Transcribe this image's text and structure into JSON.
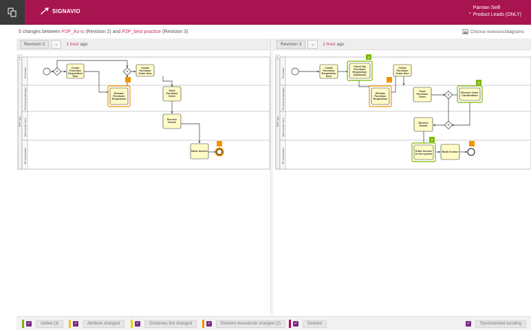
{
  "topbar": {
    "logo_text": "SIGNAVIO",
    "user_name": "Parnian Seifi",
    "user_role": "Product Leads (ONLY)",
    "app_icon": "copy-icon",
    "chevron_icon": "chevron-down-icon",
    "bg_color": "#a8144f"
  },
  "summary": {
    "count": "5",
    "text_a": " changes between ",
    "diagram_a": "P2P_As-is",
    "rev_a": " (Revision 2) and ",
    "diagram_b": "P2P_best practice",
    "rev_b": " (Revision 3)",
    "choose_label": "Choose revisions/diagrams"
  },
  "left": {
    "revision": "Revision 2",
    "time": "1 hour",
    "time_suffix": " ago",
    "pool": "ERP Sys...",
    "lanes": [
      "Purchaser",
      "Purchasing Manager",
      "Warehouse Clerk",
      "AP Accountant"
    ],
    "tasks": {
      "t1": [
        "Create",
        "Purchase",
        "Requisition",
        "Item"
      ],
      "t2": [
        "Create",
        "Purchase",
        "Order Item"
      ],
      "t3": [
        "Release",
        "Purchase",
        "Requisition"
      ],
      "t4": [
        "Send",
        "Purchase",
        "Order"
      ],
      "t5": [
        "Receive",
        "Goods"
      ],
      "t6": [
        "Book Invoice"
      ]
    }
  },
  "right": {
    "revision": "Revision 3",
    "time": "1 hour",
    "time_suffix": " ago",
    "pool": "ERP Sys...",
    "lanes": [
      "Purchaser",
      "Purchasing Manager",
      "Warehouse Clerk",
      "AP Accountant"
    ],
    "tasks": {
      "t1": [
        "Create",
        "Purchase",
        "Requisition",
        "Item"
      ],
      "t2": [
        "Check My",
        "Purchase",
        "Requisition",
        "(Optional)"
      ],
      "t3": [
        "Create",
        "Purchase",
        "Order Item"
      ],
      "t4": [
        "Release",
        "Purchase",
        "Requisition"
      ],
      "t5": [
        "Send",
        "Purchase",
        "Order"
      ],
      "t6": [
        "Receive Order",
        "Confirmation"
      ],
      "t7": [
        "Receive",
        "Goods"
      ],
      "t8": [
        "Enter Invoice",
        "to the system"
      ],
      "t9": [
        "Book Invoice"
      ]
    }
  },
  "legend": {
    "added": "Added (3)",
    "attribute": "Attribute changed",
    "dictionary": "Dictionary link changed",
    "moved": "Element moved/role changed (2)",
    "deleted": "Deleted",
    "sync": "Synchronized scrolling",
    "colors": {
      "added": "#7ab800",
      "attribute": "#f0c419",
      "dictionary": "#e8d200",
      "moved": "#f39200",
      "deleted": "#b4005a",
      "checkbox": "#7a2a86"
    }
  }
}
